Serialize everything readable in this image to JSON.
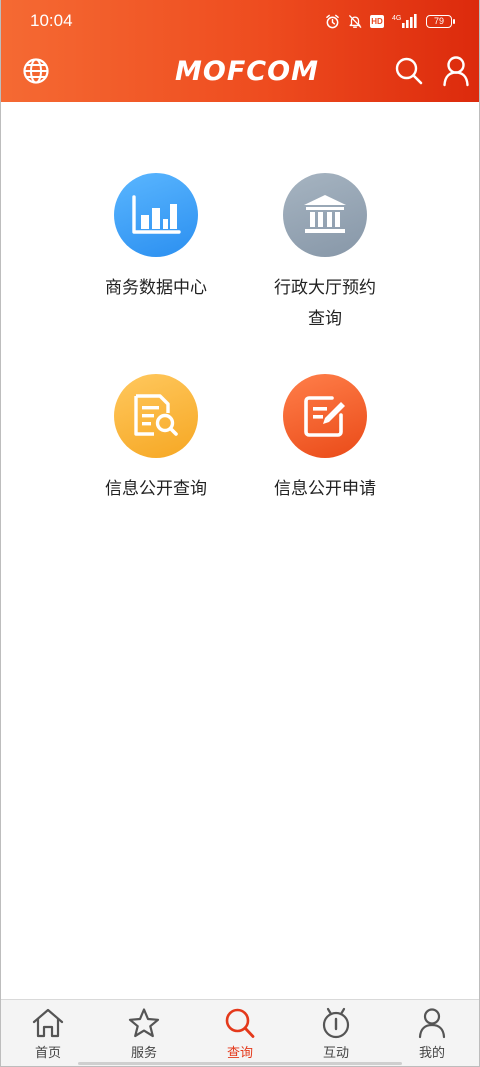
{
  "status_bar": {
    "time": "10:04",
    "network": "4G",
    "battery": "79",
    "icons": [
      "alarm-icon",
      "mute-icon",
      "hd-icon",
      "signal-icon",
      "battery-icon"
    ]
  },
  "app_bar": {
    "logo_text": "MOFCOM",
    "left_icon": "globe-icon",
    "right_icons": [
      "search-icon",
      "user-icon"
    ]
  },
  "services": [
    {
      "label": "商务数据中心",
      "icon": "bar-chart-icon",
      "color": "#3a9cf6"
    },
    {
      "label": "行政大厅预约查询",
      "icon": "building-icon",
      "color": "#97a6b6"
    },
    {
      "label": "信息公开查询",
      "icon": "document-search-icon",
      "color": "#f9b640"
    },
    {
      "label": "信息公开申请",
      "icon": "edit-icon",
      "color": "#f2602c"
    }
  ],
  "bottom_nav": {
    "active": "查询",
    "items": [
      {
        "label": "首页",
        "icon": "home-icon"
      },
      {
        "label": "服务",
        "icon": "star-icon"
      },
      {
        "label": "查询",
        "icon": "search-icon"
      },
      {
        "label": "互动",
        "icon": "interaction-icon"
      },
      {
        "label": "我的",
        "icon": "user-icon"
      }
    ]
  },
  "colors": {
    "header_start": "#f56a33",
    "header_end": "#dc2a0c",
    "accent": "#e4391b"
  }
}
